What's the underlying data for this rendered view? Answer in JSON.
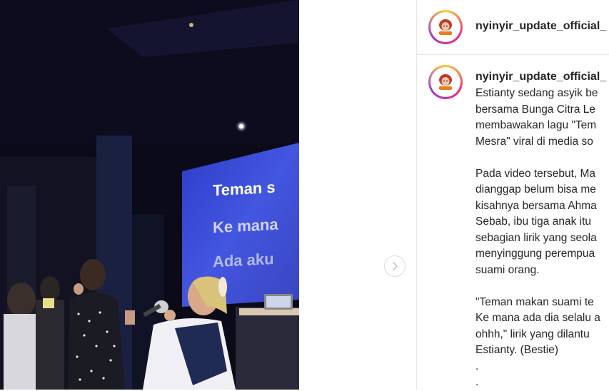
{
  "post": {
    "account": {
      "username": "nyinyir_update_official_",
      "avatar_icon": "cartoon-woman-avatar-icon"
    },
    "media": {
      "screen_lines": [
        "Teman s",
        "Ke mana",
        "Ada aku"
      ],
      "next_icon": "chevron-right-icon"
    },
    "caption": {
      "username": "nyinyir_update_official_",
      "lines": [
        "Estianty sedang asyik be",
        "bersama Bunga Citra Le",
        "membawakan lagu \"Tem",
        "Mesra\" viral di media so",
        "",
        "Pada video tersebut, Ma",
        "dianggap belum bisa me",
        "kisahnya bersama Ahma",
        "Sebab, ibu tiga anak itu",
        "sebagian lirik yang seola",
        "menyinggung perempua",
        "suami orang.",
        "",
        "\"Teman makan suami te",
        "Ke mana ada dia selalu a",
        "ohhh,\" lirik yang dilantu",
        "Estianty. (Bestie)",
        ".",
        "."
      ]
    }
  },
  "colors": {
    "ring_start": "#f9ce34",
    "ring_mid": "#ee2a7b",
    "ring_end": "#a53bc9",
    "divider": "#e6e6e6",
    "text": "#262626",
    "screen_blue": "#3c4bd6"
  }
}
